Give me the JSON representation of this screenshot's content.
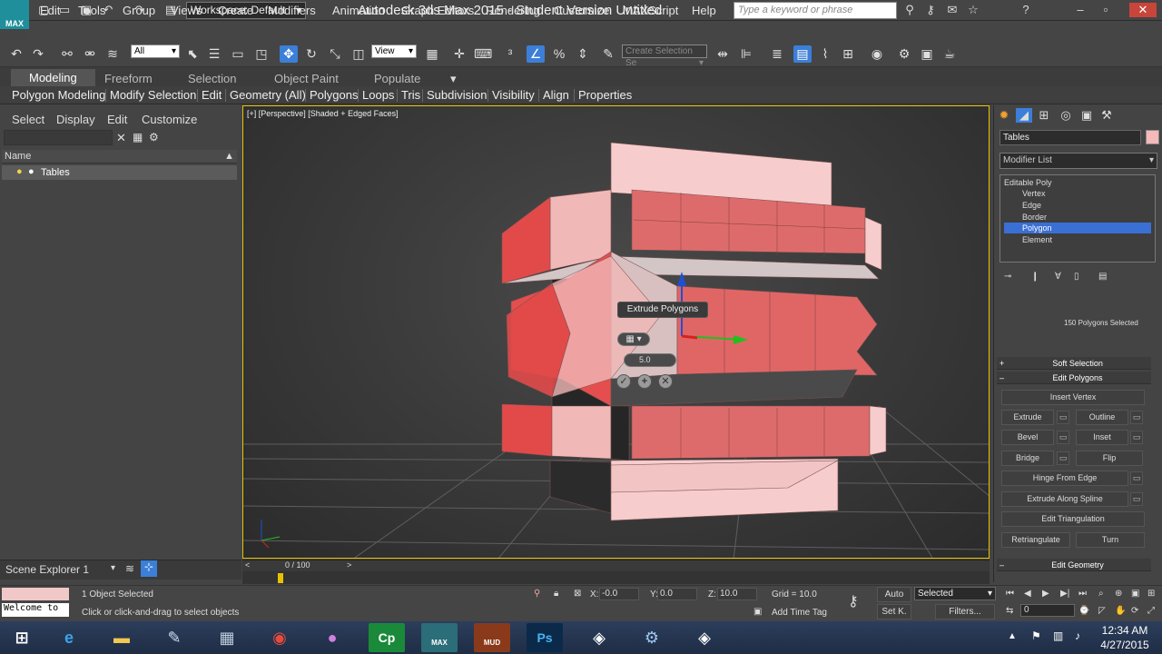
{
  "window": {
    "title": "Autodesk 3ds Max  2015  - Student Version   Untitled",
    "workspace": "Workspace: Default",
    "search_placeholder": "Type a keyword or phrase",
    "logo": "MAX"
  },
  "menu": [
    "Edit",
    "Tools",
    "Group",
    "Views",
    "Create",
    "Modifiers",
    "Animation",
    "Graph Editors",
    "Rendering",
    "Customize",
    "MAXScript",
    "Help"
  ],
  "toolbar": {
    "selection_filter": "All",
    "ref_coord": "View",
    "named_selection": "Create Selection Se"
  },
  "ribbon_tabs": [
    "Modeling",
    "Freeform",
    "Selection",
    "Object Paint",
    "Populate"
  ],
  "ribbon_items": [
    "Polygon Modeling",
    "Modify Selection",
    "Edit",
    "Geometry (All)",
    "Polygons",
    "Loops",
    "Tris",
    "Subdivision",
    "Visibility",
    "Align",
    "Properties"
  ],
  "scene_explorer": {
    "menu": [
      "Select",
      "Display",
      "Edit",
      "Customize"
    ],
    "column_header": "Name",
    "items": [
      "Tables"
    ],
    "footer": "Scene Explorer 1"
  },
  "viewport": {
    "label": "[+] [Perspective] [Shaded + Edged Faces]",
    "caddy_title": "Extrude Polygons",
    "extrude_height": "5.0",
    "gizmo_colors": {
      "x": "#d92020",
      "y": "#20c020",
      "z": "#2050d0"
    },
    "mesh_color": "#f0b8b8",
    "mesh_selected_color": "#e05a5a"
  },
  "command_panel": {
    "object_name": "Tables",
    "object_color": "#f4b9b9",
    "modifier_list": "Modifier List",
    "stack": [
      "Editable Poly",
      "Vertex",
      "Edge",
      "Border",
      "Polygon",
      "Element"
    ],
    "selected_sub": "Polygon",
    "selection_info": "150 Polygons Selected",
    "rollouts": {
      "soft": "Soft Selection",
      "edit_polygons": "Edit Polygons",
      "edit_geometry": "Edit Geometry"
    },
    "buttons": {
      "insert_vertex": "Insert Vertex",
      "extrude": "Extrude",
      "outline": "Outline",
      "bevel": "Bevel",
      "inset": "Inset",
      "bridge": "Bridge",
      "flip": "Flip",
      "hinge": "Hinge From Edge",
      "extrude_spline": "Extrude Along Spline",
      "edit_triangulation": "Edit Triangulation",
      "retriangulate": "Retriangulate",
      "turn": "Turn"
    }
  },
  "timeline": {
    "frame": "0 / 100"
  },
  "status": {
    "objects_selected": "1 Object Selected",
    "prompt": "Click or click-and-drag to select objects",
    "maxscript": "Welcome to",
    "x_label": "X:",
    "x": "-0.0",
    "y_label": "Y:",
    "y": "0.0",
    "z_label": "Z:",
    "z": "10.0",
    "grid": "Grid = 10.0",
    "add_time_tag": "Add Time Tag",
    "auto": "Auto",
    "set_key": "Set K.",
    "key_filter": "Selected",
    "filters": "Filters...",
    "frame_field": "0"
  },
  "taskbar": {
    "time": "12:34 AM",
    "date": "4/27/2015",
    "max_label": "MAX",
    "mud_label": "MUD",
    "apps": [
      "start",
      "ie",
      "explorer",
      "paint",
      "calculator",
      "chrome",
      "orb",
      "captivate",
      "3dsmax",
      "mudbox",
      "photoshop",
      "unity",
      "network",
      "unity2"
    ]
  }
}
